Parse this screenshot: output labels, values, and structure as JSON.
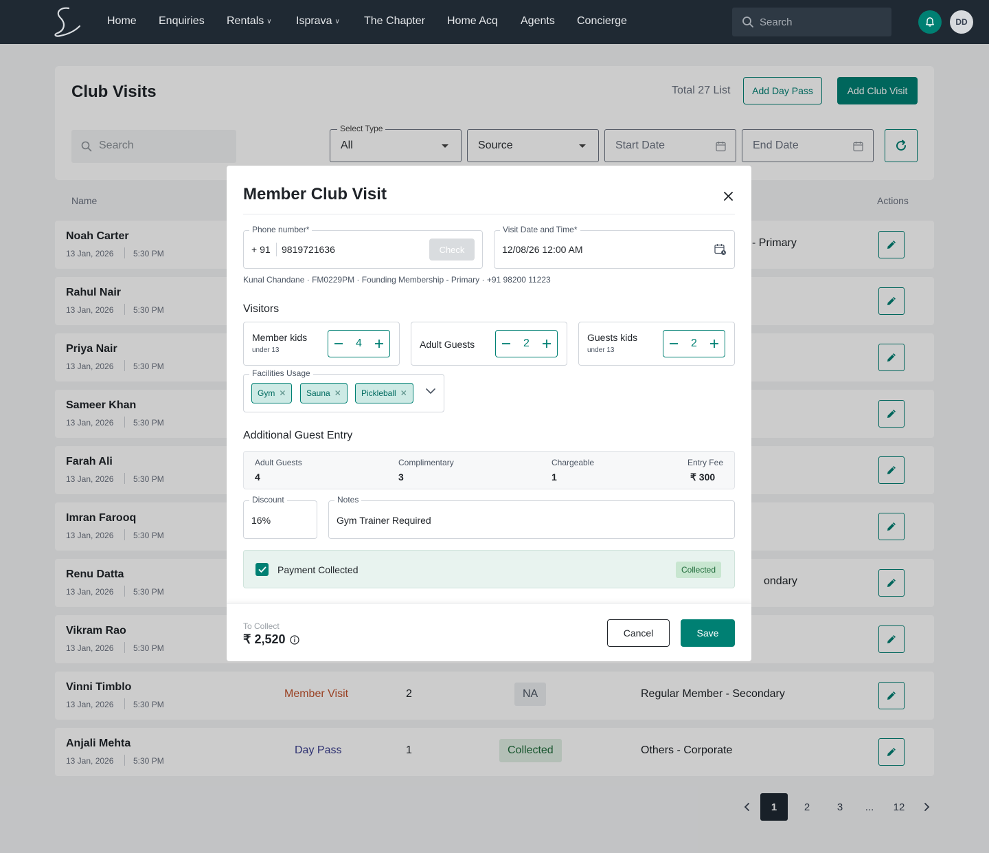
{
  "nav": {
    "items": [
      {
        "label": "Home",
        "dropdown": false
      },
      {
        "label": "Enquiries",
        "dropdown": false
      },
      {
        "label": "Rentals",
        "dropdown": true
      },
      {
        "label": "Isprava",
        "dropdown": true
      },
      {
        "label": "The Chapter",
        "dropdown": false
      },
      {
        "label": "Home Acq",
        "dropdown": false
      },
      {
        "label": "Agents",
        "dropdown": false
      },
      {
        "label": "Concierge",
        "dropdown": false
      }
    ],
    "search_placeholder": "Search",
    "avatar_initials": "DD"
  },
  "page": {
    "title": "Club Visits",
    "total_text": "Total 27 List",
    "add_day_pass": "Add Day Pass",
    "add_club_visit": "Add Club Visit",
    "search_placeholder": "Search",
    "select_type_label": "Select Type",
    "select_type_value": "All",
    "source_value": "Source",
    "start_date": "Start Date",
    "end_date": "End Date"
  },
  "table": {
    "headers": {
      "name": "Name",
      "actions": "Actions"
    },
    "rows": [
      {
        "name": "Noah Carter",
        "date": "13 Jan, 2026",
        "time": "5:30 PM",
        "type": "",
        "count": "",
        "payment": "",
        "membership": "- Primary"
      },
      {
        "name": "Rahul Nair",
        "date": "13 Jan, 2026",
        "time": "5:30 PM",
        "type": "",
        "count": "",
        "payment": "",
        "membership": ""
      },
      {
        "name": "Priya Nair",
        "date": "13 Jan, 2026",
        "time": "5:30 PM",
        "type": "",
        "count": "",
        "payment": "",
        "membership": ""
      },
      {
        "name": "Sameer Khan",
        "date": "13 Jan, 2026",
        "time": "5:30 PM",
        "type": "",
        "count": "",
        "payment": "",
        "membership": ""
      },
      {
        "name": "Farah Ali",
        "date": "13 Jan, 2026",
        "time": "5:30 PM",
        "type": "",
        "count": "",
        "payment": "",
        "membership": ""
      },
      {
        "name": "Imran Farooq",
        "date": "13 Jan, 2026",
        "time": "5:30 PM",
        "type": "",
        "count": "",
        "payment": "",
        "membership": ""
      },
      {
        "name": "Renu Datta",
        "date": "13 Jan, 2026",
        "time": "5:30 PM",
        "type": "",
        "count": "",
        "payment": "",
        "membership": "ondary"
      },
      {
        "name": "Vikram Rao",
        "date": "13 Jan, 2026",
        "time": "5:30 PM",
        "type": "",
        "count": "",
        "payment": "",
        "membership": ""
      },
      {
        "name": "Vinni Timblo",
        "date": "13 Jan, 2026",
        "time": "5:30 PM",
        "type": "Member Visit",
        "count": "2",
        "payment": "NA",
        "membership": "Regular Member - Secondary"
      },
      {
        "name": "Anjali Mehta",
        "date": "13 Jan, 2026",
        "time": "5:30 PM",
        "type": "Day Pass",
        "count": "1",
        "payment": "Collected",
        "membership": "Others - Corporate"
      }
    ]
  },
  "pagination": {
    "pages": [
      "1",
      "2",
      "3",
      "...",
      "12"
    ],
    "active": "1"
  },
  "modal": {
    "title": "Member Club Visit",
    "phone_label": "Phone number*",
    "country_code": "+ 91",
    "phone_value": "9819721636",
    "check_label": "Check",
    "datetime_label": "Visit Date and Time*",
    "datetime_value": "12/08/26  12:00 AM",
    "member_info": "Kunal Chandane ·  FM0229PM · Founding Membership - Primary · +91 98200 11223",
    "visitors_title": "Visitors",
    "steppers": [
      {
        "label": "Member kids",
        "sub": "under 13",
        "value": "4"
      },
      {
        "label": "Adult Guests",
        "sub": "",
        "value": "2"
      },
      {
        "label": "Guests kids",
        "sub": "under 13",
        "value": "2"
      }
    ],
    "facilities_label": "Facilities Usage",
    "facilities": [
      "Gym",
      "Sauna",
      "Pickleball"
    ],
    "additional_title": "Additional Guest Entry",
    "summary": {
      "adult_guests_label": "Adult Guests",
      "adult_guests": "4",
      "complimentary_label": "Complimentary",
      "complimentary": "3",
      "chargeable_label": "Chargeable",
      "chargeable": "1",
      "entry_fee_label": "Entry Fee",
      "entry_fee": "₹ 300"
    },
    "discount_label": "Discount",
    "discount_value": "16%",
    "notes_label": "Notes",
    "notes_value": "Gym Trainer Required",
    "payment_label": "Payment Collected",
    "payment_badge": "Collected",
    "payment_checked": true,
    "to_collect_label": "To Collect",
    "to_collect_value": "₹ 2,520",
    "cancel": "Cancel",
    "save": "Save"
  },
  "colors": {
    "accent": "#008073",
    "nav_bg": "#1f2933",
    "member_visit": "#c0512b",
    "day_pass": "#3b3f8f"
  }
}
